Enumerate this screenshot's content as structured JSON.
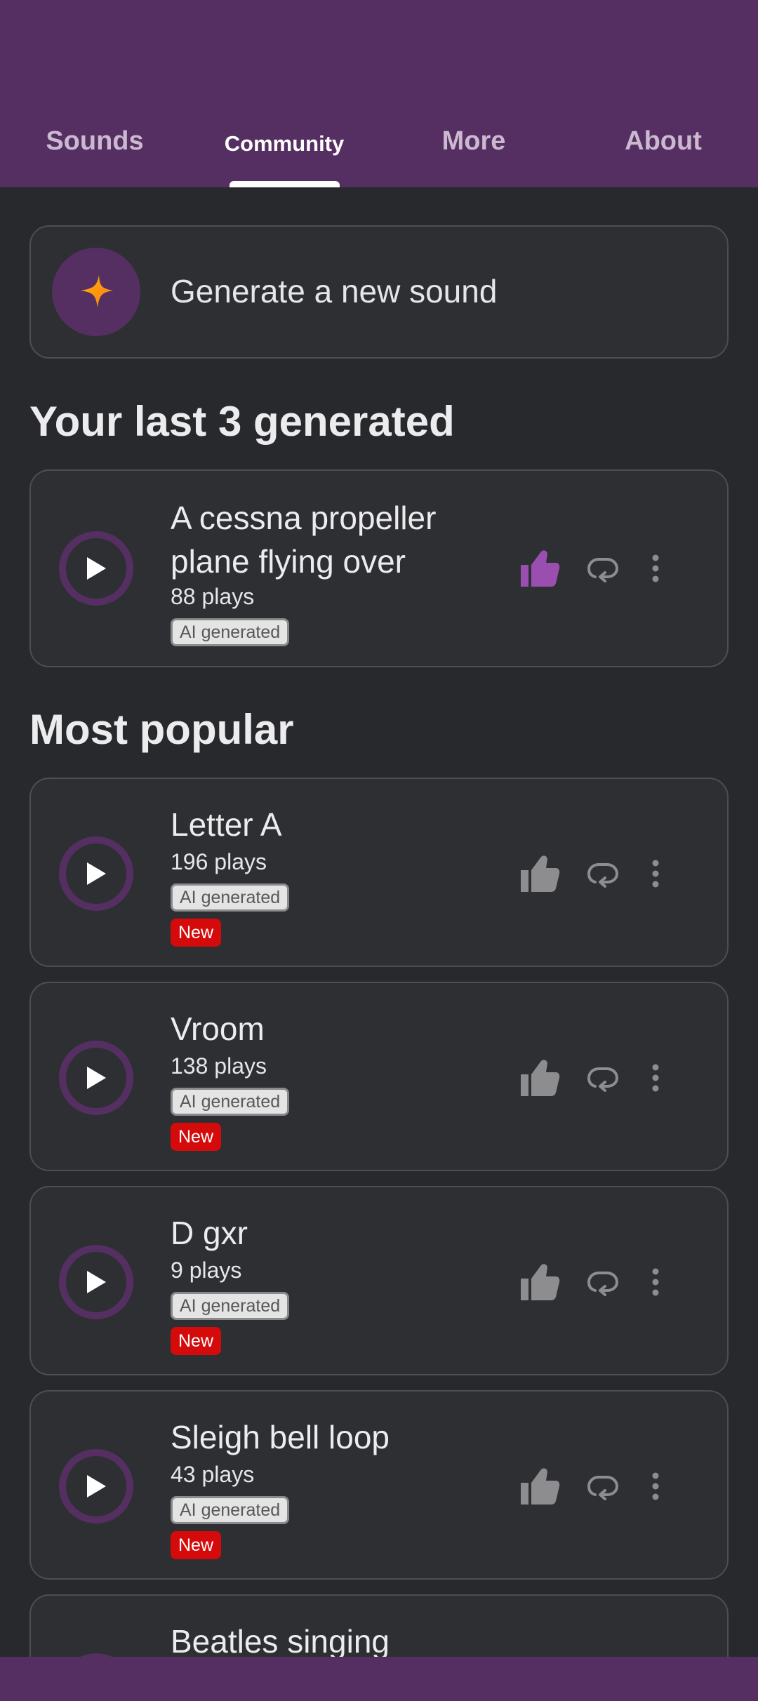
{
  "tabs": [
    {
      "label": "Sounds",
      "active": false
    },
    {
      "label": "Community",
      "active": true
    },
    {
      "label": "More",
      "active": false
    },
    {
      "label": "About",
      "active": false
    }
  ],
  "generate": {
    "label": "Generate a new sound",
    "icon": "sparkle-icon"
  },
  "sections": {
    "last_generated": "Your last 3 generated",
    "most_popular": "Most popular"
  },
  "last_generated": [
    {
      "title_line1": "A cessna propeller",
      "title_line2": "plane flying over",
      "plays": "88 plays",
      "badge": "AI generated",
      "liked": true
    }
  ],
  "popular": [
    {
      "title": "Letter A",
      "plays": "196 plays",
      "badge": "AI generated",
      "new_badge": "New"
    },
    {
      "title": "Vroom",
      "plays": "138 plays",
      "badge": "AI generated",
      "new_badge": "New"
    },
    {
      "title": "D gxr",
      "plays": "9 plays",
      "badge": "AI generated",
      "new_badge": "New"
    },
    {
      "title": "Sleigh bell loop",
      "plays": "43 plays",
      "badge": "AI generated",
      "new_badge": "New"
    },
    {
      "title": "Beatles singing"
    }
  ],
  "colors": {
    "primary": "#552f62",
    "background": "#28292c",
    "card": "#2e2f33",
    "liked": "#9a4fb0",
    "icon_muted": "#8d8d90",
    "new_badge": "#d50b0b"
  }
}
